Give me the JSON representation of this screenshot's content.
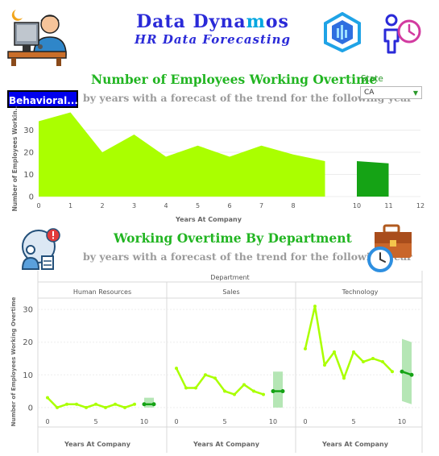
{
  "brand": {
    "title_part1": "Data Dyna",
    "title_part2": "m",
    "title_part3": "os",
    "subtitle": "HR Data Forecasting"
  },
  "colors": {
    "series": "#aaff00",
    "forecast": "#15a315",
    "band": "#a8e2a8",
    "title": "#22b522",
    "button": "#0000ee"
  },
  "filter_button": {
    "label": "Behavioral..."
  },
  "state_filter": {
    "label": "State",
    "value": "CA"
  },
  "icons": [
    "worker-at-computer-icon",
    "company-logo-icon",
    "employee-time-icon",
    "alert-worker-icon",
    "briefcase-clock-icon",
    "moon-icon",
    "dropdown-caret-icon"
  ],
  "chart_top": {
    "title": "Number of  Employees Working Overtime",
    "subtitle": "by years with a forecast of the trend for the following year",
    "ylabel": "Number of Employees Workin..",
    "xlabel": "Years At Company"
  },
  "chart_bottom": {
    "title": "Working Overtime By Department",
    "subtitle": "by years with a forecast of the trend for the following year",
    "column_header": "Department",
    "ylabel": "Number of Employees Working Overtime",
    "xlabel": "Years At Company"
  },
  "chart_data": [
    {
      "type": "area",
      "x": [
        0,
        1,
        2,
        3,
        4,
        5,
        6,
        7,
        8,
        9
      ],
      "values": [
        34,
        38,
        20,
        28,
        18,
        23,
        18,
        23,
        19,
        16
      ],
      "forecast": {
        "x": [
          10,
          11
        ],
        "values": [
          16,
          15
        ]
      },
      "xlim": [
        0,
        12
      ],
      "ylim": [
        0,
        40
      ],
      "xticks": [
        0,
        1,
        2,
        3,
        4,
        5,
        6,
        7,
        8,
        10,
        11,
        12
      ],
      "yticks": [
        0,
        10,
        20,
        30
      ],
      "title": "Number of  Employees Working Overtime",
      "xlabel": "Years At Company",
      "ylabel": "Number of Employees Workin.."
    },
    {
      "type": "line",
      "panels": [
        {
          "name": "Human Resources",
          "x": [
            0,
            1,
            2,
            3,
            4,
            5,
            6,
            7,
            8,
            9
          ],
          "values": [
            3,
            0,
            1,
            1,
            0,
            1,
            0,
            1,
            0,
            1
          ],
          "forecast": {
            "x": [
              10,
              11
            ],
            "values": [
              1,
              1
            ],
            "lower": [
              0,
              0
            ],
            "upper": [
              3,
              3
            ]
          }
        },
        {
          "name": "Sales",
          "x": [
            0,
            1,
            2,
            3,
            4,
            5,
            6,
            7,
            8,
            9
          ],
          "values": [
            12,
            6,
            6,
            10,
            9,
            5,
            4,
            7,
            5,
            4
          ],
          "forecast": {
            "x": [
              10,
              11
            ],
            "values": [
              5,
              5
            ],
            "lower": [
              0,
              0
            ],
            "upper": [
              11,
              11
            ]
          }
        },
        {
          "name": "Technology",
          "x": [
            0,
            1,
            2,
            3,
            4,
            5,
            6,
            7,
            8,
            9
          ],
          "values": [
            18,
            31,
            13,
            17,
            9,
            17,
            14,
            15,
            14,
            11
          ],
          "forecast": {
            "x": [
              10,
              11
            ],
            "values": [
              11,
              10
            ],
            "lower": [
              2,
              1
            ],
            "upper": [
              21,
              20
            ]
          }
        }
      ],
      "xticks": [
        0,
        5,
        10
      ],
      "yticks": [
        0,
        10,
        20,
        30
      ],
      "ylim": [
        -3,
        33
      ],
      "xlabel": "Years At Company",
      "ylabel": "Number of Employees Working Overtime"
    }
  ]
}
